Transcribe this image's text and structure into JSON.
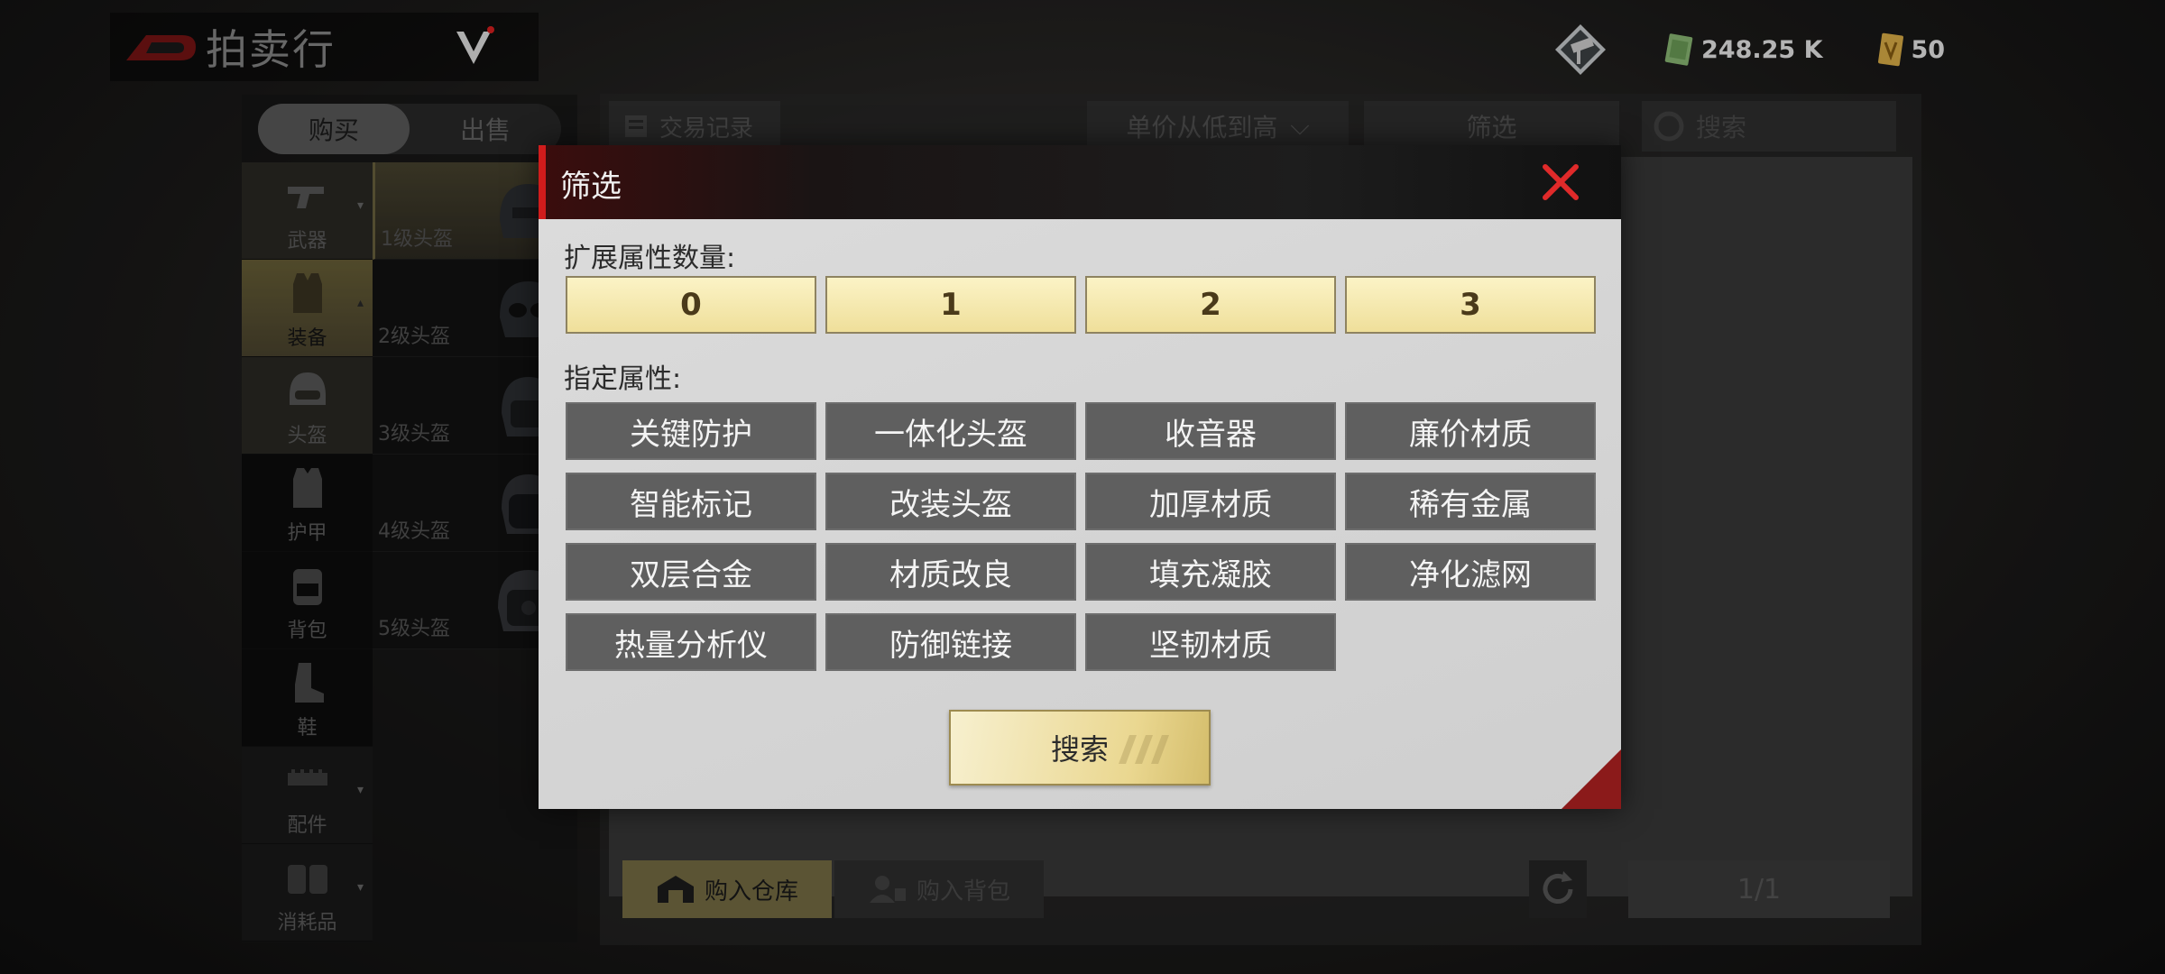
{
  "header": {
    "title": "拍卖行",
    "money_value": "248.25 K",
    "ticket_value": "50"
  },
  "left_panel": {
    "tabs": [
      {
        "label": "购买",
        "active": true
      },
      {
        "label": "出售",
        "active": false
      }
    ],
    "categories": [
      {
        "label": "武器",
        "icon": "pistol-icon"
      },
      {
        "label": "装备",
        "icon": "vest-icon",
        "selected": true
      },
      {
        "label": "头盔",
        "icon": "helmet-icon"
      },
      {
        "label": "护甲",
        "icon": "armor-icon"
      },
      {
        "label": "背包",
        "icon": "backpack-icon"
      },
      {
        "label": "鞋",
        "icon": "boot-icon"
      },
      {
        "label": "配件",
        "icon": "attachment-icon"
      },
      {
        "label": "消耗品",
        "icon": "consumable-icon"
      }
    ],
    "subcategories": [
      {
        "label": "1级头盔",
        "selected": true
      },
      {
        "label": "2级头盔"
      },
      {
        "label": "3级头盔"
      },
      {
        "label": "4级头盔"
      },
      {
        "label": "5级头盔"
      }
    ]
  },
  "toolbar": {
    "trade_record": "交易记录",
    "sort": "单价从低到高",
    "filter": "筛选",
    "search_placeholder": "搜索"
  },
  "footer": {
    "buy_warehouse": "购入仓库",
    "buy_backpack": "购入背包",
    "page": "1/1"
  },
  "modal": {
    "title": "筛选",
    "count_label": "扩展属性数量:",
    "counts": [
      "0",
      "1",
      "2",
      "3"
    ],
    "attr_label": "指定属性:",
    "attributes": [
      "关键防护",
      "一体化头盔",
      "收音器",
      "廉价材质",
      "智能标记",
      "改装头盔",
      "加厚材质",
      "稀有金属",
      "双层合金",
      "材质改良",
      "填充凝胶",
      "净化滤网",
      "热量分析仪",
      "防御链接",
      "坚韧材质"
    ],
    "search_label": "搜索"
  },
  "colors": {
    "accent_red": "#d01c1c",
    "gold": "#efdf9a",
    "attr_bg": "#5f5f5f"
  }
}
